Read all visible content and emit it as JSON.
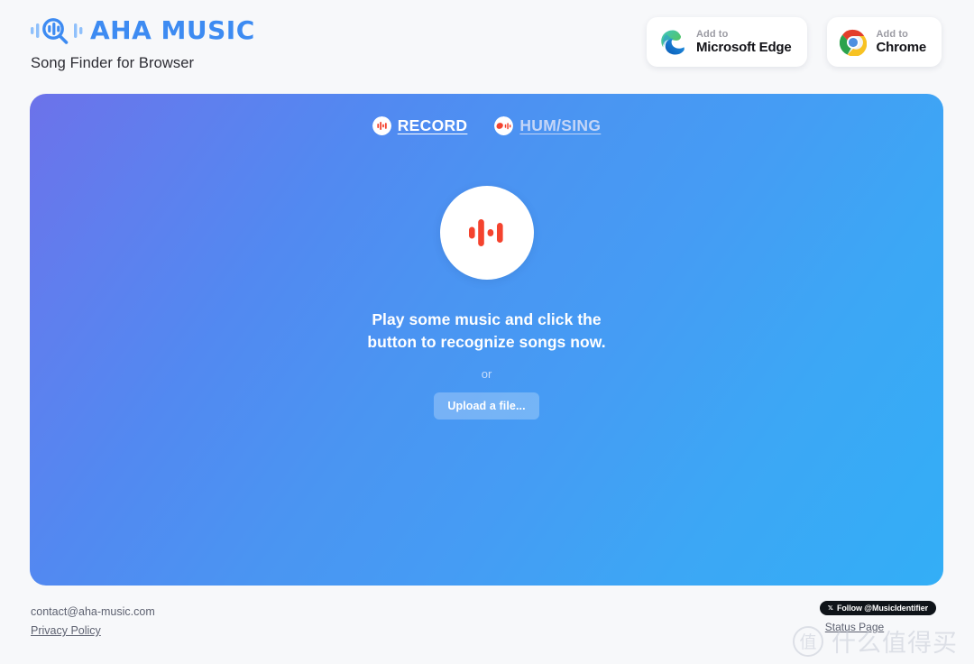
{
  "header": {
    "brand_name": "AHA MUSIC",
    "tagline": "Song Finder for Browser",
    "logo_icon": "magnifier-waveform-icon",
    "brand_color": "#3d8bf2",
    "store_buttons": [
      {
        "sub_label": "Add to",
        "main_label": "Microsoft Edge",
        "icon": "microsoft-edge-icon"
      },
      {
        "sub_label": "Add to",
        "main_label": "Chrome",
        "icon": "google-chrome-icon"
      }
    ]
  },
  "panel": {
    "gradient_from": "#6c72ea",
    "gradient_to": "#33aef6",
    "tabs": [
      {
        "label": "RECORD",
        "icon": "waveform-circle-icon",
        "active": true
      },
      {
        "label": "HUM/SING",
        "icon": "lips-waveform-icon",
        "active": false
      }
    ],
    "record_button": {
      "icon": "audio-bars-icon",
      "accent_color": "#f4432e"
    },
    "hint_line_1": "Play some music and click the",
    "hint_line_2": "button to recognize songs now.",
    "or_label": "or",
    "upload_label": "Upload a file..."
  },
  "footer": {
    "contact_email": "contact@aha-music.com",
    "privacy_label": "Privacy Policy",
    "x_follow": {
      "glyph_icon": "x-twitter-icon",
      "label": "Follow @MusicIdentifier"
    },
    "status_label": "Status Page"
  },
  "watermark": {
    "mark_char": "值",
    "text": "什么值得买"
  }
}
